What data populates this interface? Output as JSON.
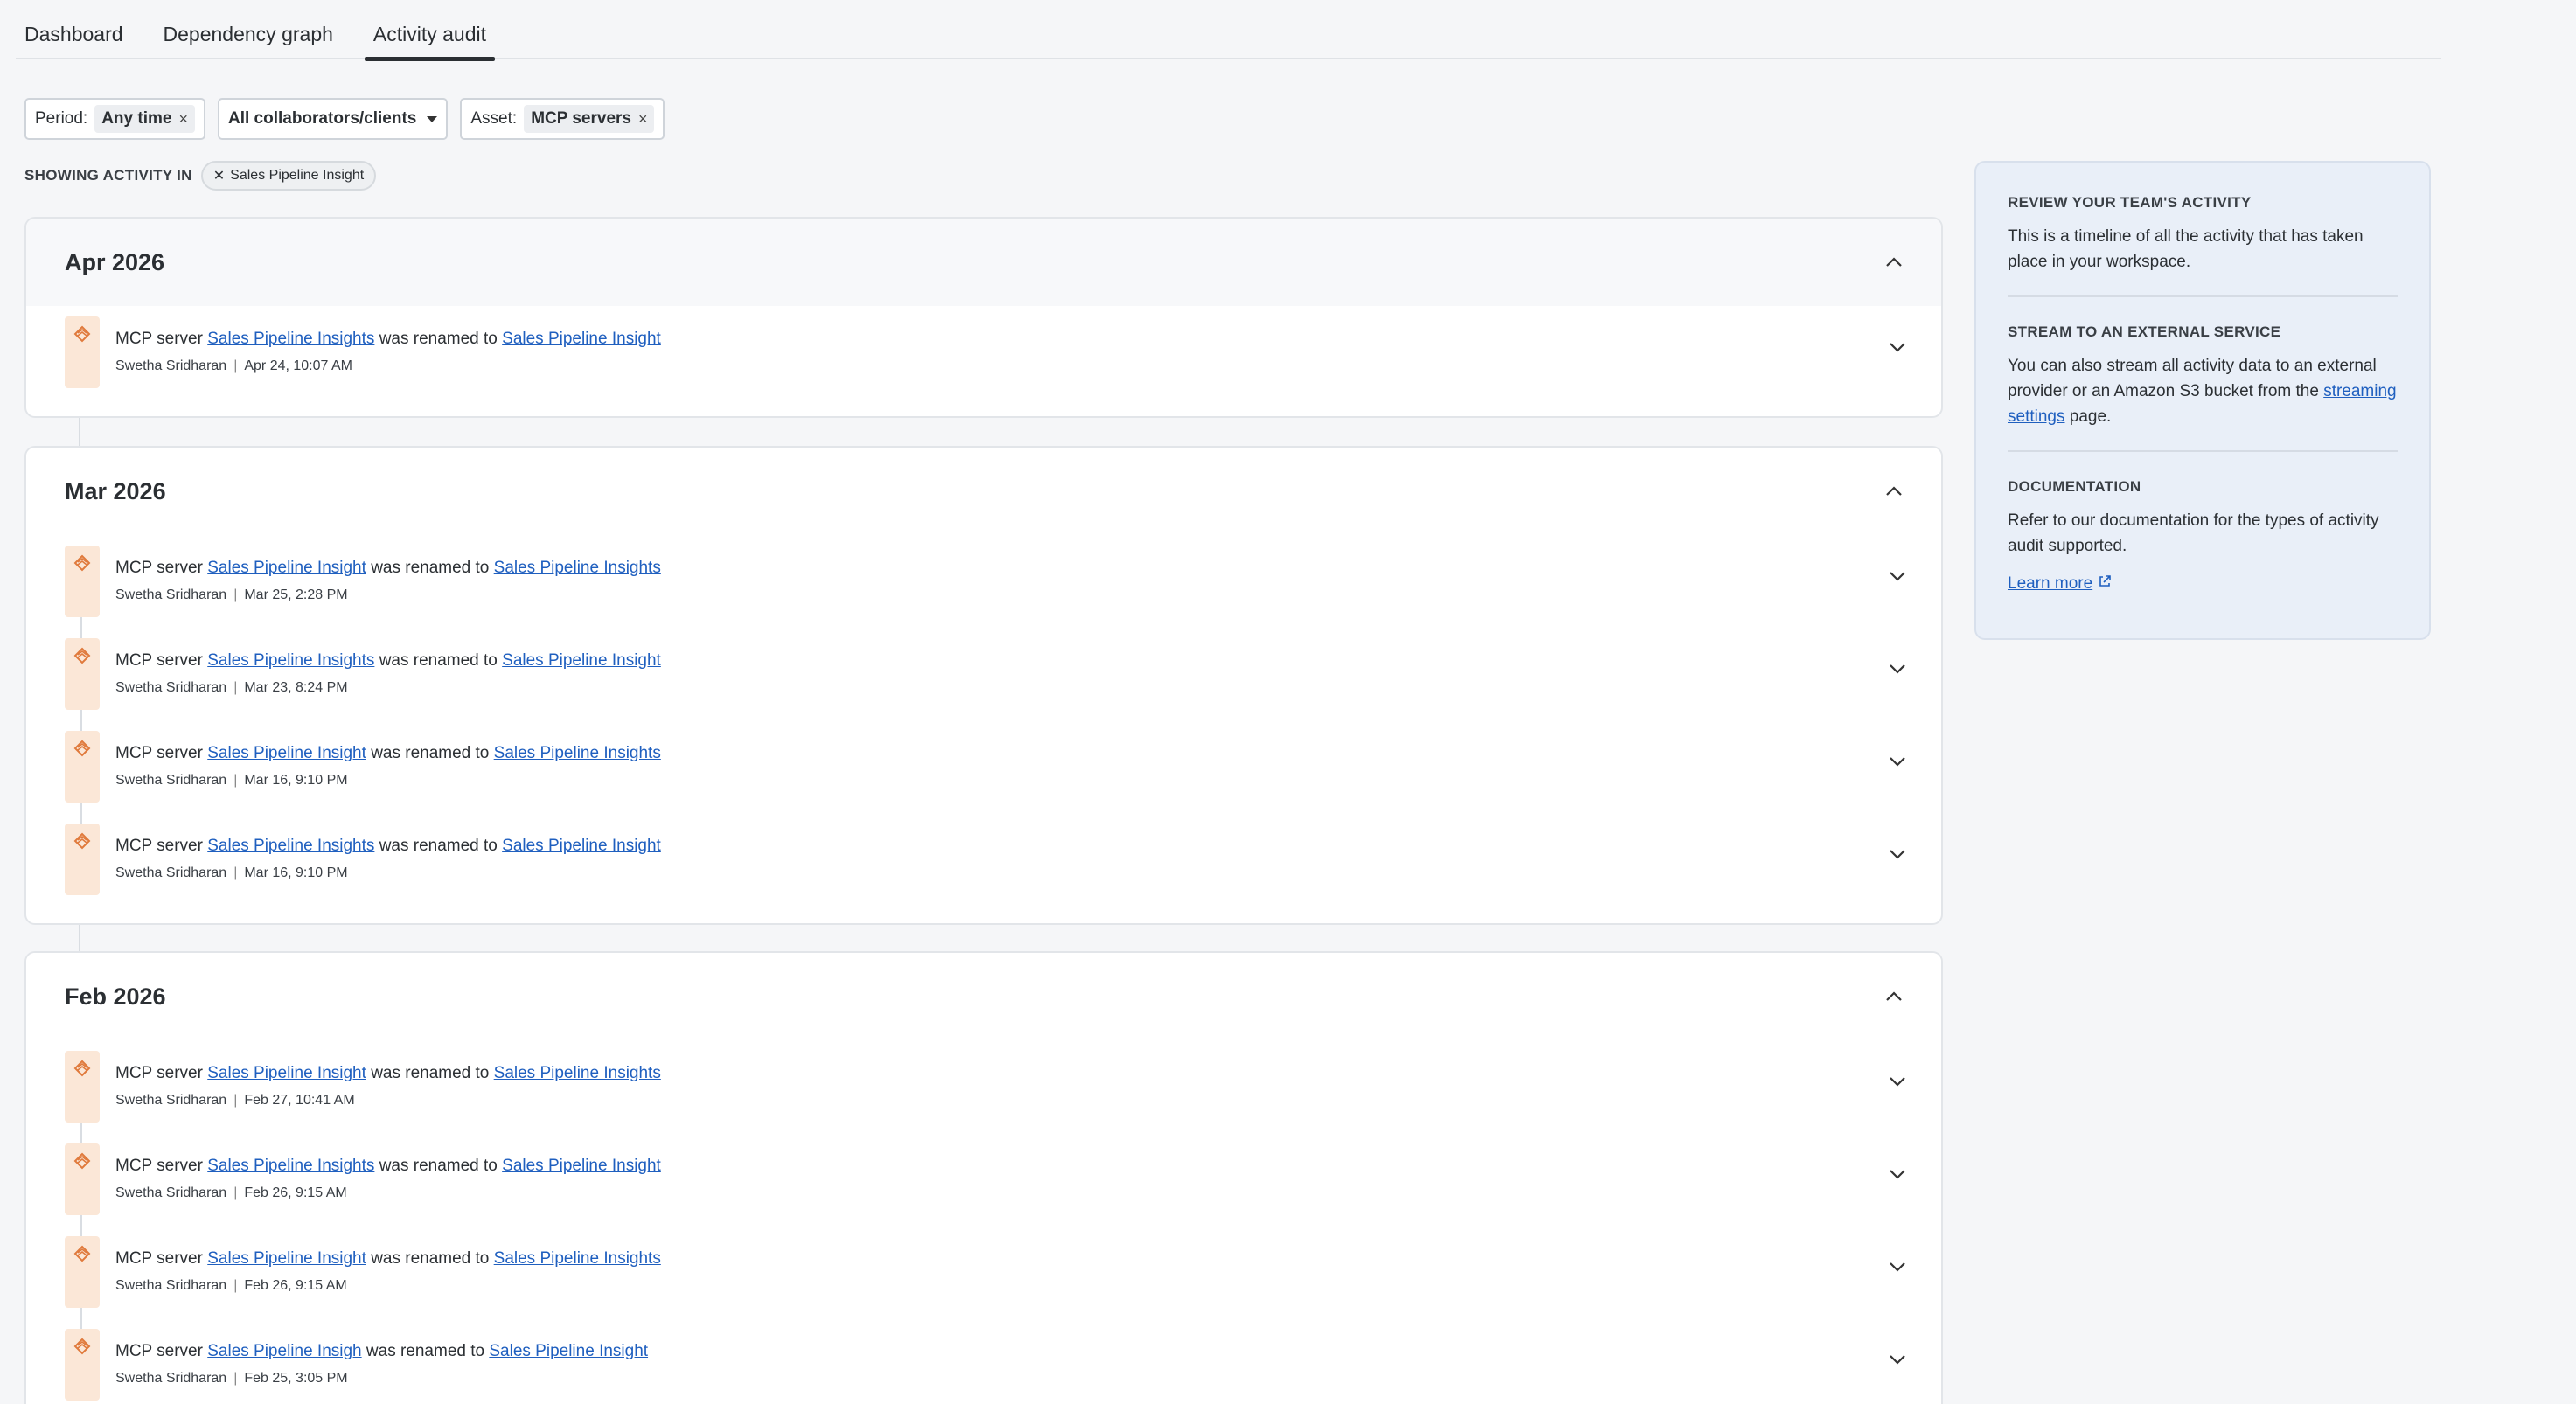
{
  "tabs": [
    {
      "label": "Dashboard"
    },
    {
      "label": "Dependency graph"
    },
    {
      "label": "Activity audit"
    }
  ],
  "filters": {
    "period_label": "Period:",
    "period_value": "Any time",
    "collaborators_value": "All collaborators/clients",
    "asset_label": "Asset:",
    "asset_value": "MCP servers"
  },
  "showing": {
    "label": "SHOWING ACTIVITY IN",
    "scope": "Sales Pipeline Insight"
  },
  "months": [
    {
      "label": "Apr 2026",
      "entries": [
        {
          "prefix": "MCP server",
          "from": "Sales Pipeline Insights",
          "verb": "was renamed to",
          "to": "Sales Pipeline Insight",
          "user": "Swetha Sridharan",
          "time": "Apr 24, 10:07 AM"
        }
      ]
    },
    {
      "label": "Mar 2026",
      "entries": [
        {
          "prefix": "MCP server",
          "from": "Sales Pipeline Insight",
          "verb": "was renamed to",
          "to": "Sales Pipeline Insights",
          "user": "Swetha Sridharan",
          "time": "Mar 25, 2:28 PM"
        },
        {
          "prefix": "MCP server",
          "from": "Sales Pipeline Insights",
          "verb": "was renamed to",
          "to": "Sales Pipeline Insight",
          "user": "Swetha Sridharan",
          "time": "Mar 23, 8:24 PM"
        },
        {
          "prefix": "MCP server",
          "from": "Sales Pipeline Insight",
          "verb": "was renamed to",
          "to": "Sales Pipeline Insights",
          "user": "Swetha Sridharan",
          "time": "Mar 16, 9:10 PM"
        },
        {
          "prefix": "MCP server",
          "from": "Sales Pipeline Insights",
          "verb": "was renamed to",
          "to": "Sales Pipeline Insight",
          "user": "Swetha Sridharan",
          "time": "Mar 16, 9:10 PM"
        }
      ]
    },
    {
      "label": "Feb 2026",
      "entries": [
        {
          "prefix": "MCP server",
          "from": "Sales Pipeline Insight",
          "verb": "was renamed to",
          "to": "Sales Pipeline Insights",
          "user": "Swetha Sridharan",
          "time": "Feb 27, 10:41 AM"
        },
        {
          "prefix": "MCP server",
          "from": "Sales Pipeline Insights",
          "verb": "was renamed to",
          "to": "Sales Pipeline Insight",
          "user": "Swetha Sridharan",
          "time": "Feb 26, 9:15 AM"
        },
        {
          "prefix": "MCP server",
          "from": "Sales Pipeline Insight",
          "verb": "was renamed to",
          "to": "Sales Pipeline Insights",
          "user": "Swetha Sridharan",
          "time": "Feb 26, 9:15 AM"
        },
        {
          "prefix": "MCP server",
          "from": "Sales Pipeline Insigh",
          "verb": "was renamed to",
          "to": "Sales Pipeline Insight",
          "user": "Swetha Sridharan",
          "time": "Feb 25, 3:05 PM"
        }
      ]
    }
  ],
  "panel": {
    "review_title": "REVIEW YOUR TEAM'S ACTIVITY",
    "review_text": "This is a timeline of all the activity that has taken place in your workspace.",
    "stream_title": "STREAM TO AN EXTERNAL SERVICE",
    "stream_text_before": "You can also stream all activity data to an external provider or an Amazon S3 bucket from the ",
    "stream_link": "streaming settings",
    "stream_text_after": " page.",
    "docs_title": "DOCUMENTATION",
    "docs_text": "Refer to our documentation for the types of activity audit supported.",
    "learn_more": "Learn more"
  },
  "colors": {
    "link": "#1f5fbf",
    "icon_bg": "#fbe7d7",
    "icon_accent": "#e07a3c",
    "panel_bg": "#e9eff8"
  }
}
